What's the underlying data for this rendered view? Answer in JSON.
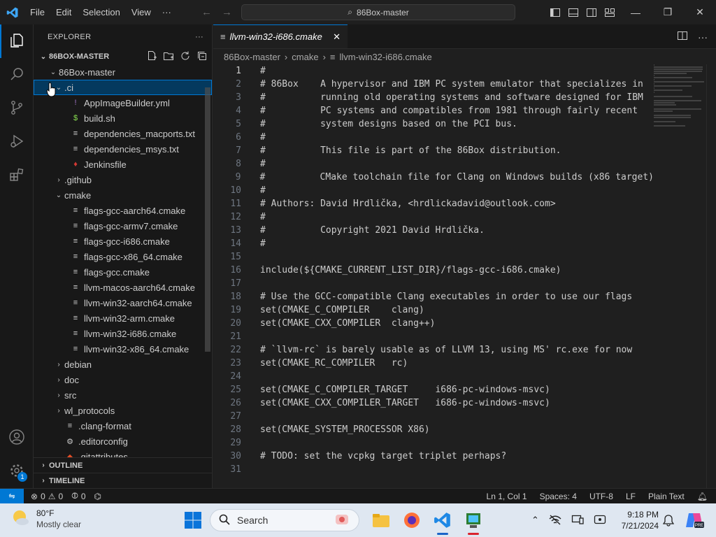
{
  "titlebar": {
    "menu": [
      "File",
      "Edit",
      "Selection",
      "View",
      "···"
    ],
    "search_text": "86Box-master"
  },
  "explorer": {
    "header": "EXPLORER",
    "root_label": "86BOX-MASTER",
    "tree": [
      {
        "label": "86Box-master",
        "depth": 0,
        "twisty": "v",
        "icon": ""
      },
      {
        "label": ".ci",
        "depth": 1,
        "twisty": "v",
        "icon": "",
        "selected": true
      },
      {
        "label": "AppImageBuilder.yml",
        "depth": 2,
        "icon": "!",
        "icon_color": "#a074c4"
      },
      {
        "label": "build.sh",
        "depth": 2,
        "icon": "$",
        "icon_color": "#89e051"
      },
      {
        "label": "dependencies_macports.txt",
        "depth": 2,
        "icon": "≡",
        "icon_color": "#cccccc"
      },
      {
        "label": "dependencies_msys.txt",
        "depth": 2,
        "icon": "≡",
        "icon_color": "#cccccc"
      },
      {
        "label": "Jenkinsfile",
        "depth": 2,
        "icon": "♦",
        "icon_color": "#d33833"
      },
      {
        "label": ".github",
        "depth": 1,
        "twisty": ">",
        "icon": ""
      },
      {
        "label": "cmake",
        "depth": 1,
        "twisty": "v",
        "icon": ""
      },
      {
        "label": "flags-gcc-aarch64.cmake",
        "depth": 2,
        "icon": "≡",
        "icon_color": "#cccccc"
      },
      {
        "label": "flags-gcc-armv7.cmake",
        "depth": 2,
        "icon": "≡",
        "icon_color": "#cccccc"
      },
      {
        "label": "flags-gcc-i686.cmake",
        "depth": 2,
        "icon": "≡",
        "icon_color": "#cccccc"
      },
      {
        "label": "flags-gcc-x86_64.cmake",
        "depth": 2,
        "icon": "≡",
        "icon_color": "#cccccc"
      },
      {
        "label": "flags-gcc.cmake",
        "depth": 2,
        "icon": "≡",
        "icon_color": "#cccccc"
      },
      {
        "label": "llvm-macos-aarch64.cmake",
        "depth": 2,
        "icon": "≡",
        "icon_color": "#cccccc"
      },
      {
        "label": "llvm-win32-aarch64.cmake",
        "depth": 2,
        "icon": "≡",
        "icon_color": "#cccccc"
      },
      {
        "label": "llvm-win32-arm.cmake",
        "depth": 2,
        "icon": "≡",
        "icon_color": "#cccccc"
      },
      {
        "label": "llvm-win32-i686.cmake",
        "depth": 2,
        "icon": "≡",
        "icon_color": "#cccccc"
      },
      {
        "label": "llvm-win32-x86_64.cmake",
        "depth": 2,
        "icon": "≡",
        "icon_color": "#cccccc"
      },
      {
        "label": "debian",
        "depth": 1,
        "twisty": ">",
        "icon": ""
      },
      {
        "label": "doc",
        "depth": 1,
        "twisty": ">",
        "icon": ""
      },
      {
        "label": "src",
        "depth": 1,
        "twisty": ">",
        "icon": ""
      },
      {
        "label": "wl_protocols",
        "depth": 1,
        "twisty": ">",
        "icon": ""
      },
      {
        "label": ".clang-format",
        "depth": 1,
        "icon": "≡",
        "icon_color": "#cccccc"
      },
      {
        "label": ".editorconfig",
        "depth": 1,
        "icon": "⚙",
        "icon_color": "#cccccc"
      },
      {
        "label": ".gitattributes",
        "depth": 1,
        "icon": "◆",
        "icon_color": "#e44d26"
      }
    ],
    "outline_label": "OUTLINE",
    "timeline_label": "TIMELINE"
  },
  "editor": {
    "tab_label": "llvm-win32-i686.cmake",
    "breadcrumb": [
      "86Box-master",
      "cmake",
      "llvm-win32-i686.cmake"
    ],
    "lines": [
      "#",
      "# 86Box    A hypervisor and IBM PC system emulator that specializes in",
      "#          running old operating systems and software designed for IBM",
      "#          PC systems and compatibles from 1981 through fairly recent",
      "#          system designs based on the PCI bus.",
      "#",
      "#          This file is part of the 86Box distribution.",
      "#",
      "#          CMake toolchain file for Clang on Windows builds (x86 target)",
      "#",
      "# Authors: David Hrdlička, <hrdlickadavid@outlook.com>",
      "#",
      "#          Copyright 2021 David Hrdlička.",
      "#",
      "",
      "include(${CMAKE_CURRENT_LIST_DIR}/flags-gcc-i686.cmake)",
      "",
      "# Use the GCC-compatible Clang executables in order to use our flags",
      "set(CMAKE_C_COMPILER    clang)",
      "set(CMAKE_CXX_COMPILER  clang++)",
      "",
      "# `llvm-rc` is barely usable as of LLVM 13, using MS' rc.exe for now",
      "set(CMAKE_RC_COMPILER   rc)",
      "",
      "set(CMAKE_C_COMPILER_TARGET     i686-pc-windows-msvc)",
      "set(CMAKE_CXX_COMPILER_TARGET   i686-pc-windows-msvc)",
      "",
      "set(CMAKE_SYSTEM_PROCESSOR X86)",
      "",
      "# TODO: set the vcpkg target triplet perhaps?",
      ""
    ]
  },
  "statusbar": {
    "errors": "0",
    "warnings": "0",
    "ports": "0",
    "position": "Ln 1, Col 1",
    "spaces": "Spaces: 4",
    "encoding": "UTF-8",
    "eol": "LF",
    "language": "Plain Text",
    "accounts_badge": "1"
  },
  "taskbar": {
    "temp": "80°F",
    "weather": "Mostly clear",
    "search_placeholder": "Search",
    "time": "9:18 PM",
    "date": "7/21/2024"
  },
  "colors": {
    "accent": "#0078d4",
    "editor_bg": "#1f1f1f",
    "sidebar_bg": "#181818",
    "taskbar_bg": "#dfe7f1"
  }
}
